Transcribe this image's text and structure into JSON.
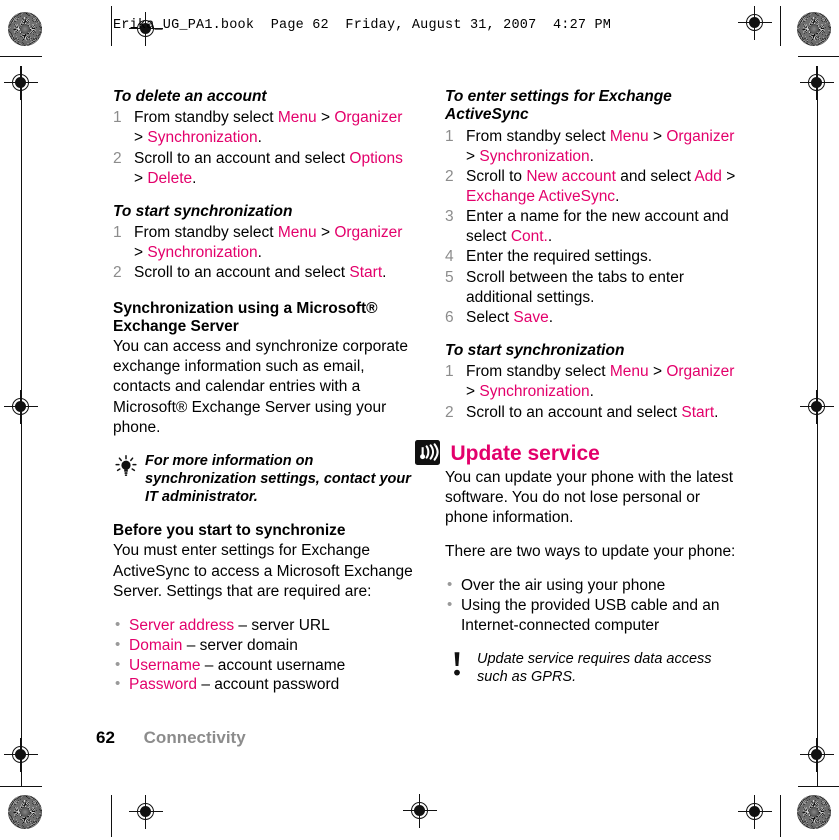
{
  "colors": {
    "accent": "#E3006B",
    "muted": "#8c8c8c",
    "text": "#000000"
  },
  "header": {
    "text": "Erika_UG_PA1.book  Page 62  Friday, August 31, 2007  4:27 PM"
  },
  "footer": {
    "page_number": "62",
    "chapter": "Connectivity"
  },
  "left_column": {
    "h_delete": "To delete an account",
    "delete_steps": [
      {
        "num": "1",
        "parts": [
          {
            "t": "From standby select ",
            "c": "blk"
          },
          {
            "t": "Menu",
            "c": "kw"
          },
          {
            "t": " > ",
            "c": "blk"
          },
          {
            "t": "Organizer",
            "c": "kw"
          },
          {
            "t": " > ",
            "c": "blk"
          },
          {
            "t": "Synchronization",
            "c": "kw"
          },
          {
            "t": ".",
            "c": "blk"
          }
        ]
      },
      {
        "num": "2",
        "parts": [
          {
            "t": "Scroll to an account and select ",
            "c": "blk"
          },
          {
            "t": "Options",
            "c": "kw"
          },
          {
            "t": " > ",
            "c": "blk"
          },
          {
            "t": "Delete",
            "c": "kw"
          },
          {
            "t": ".",
            "c": "blk"
          }
        ]
      }
    ],
    "h_start_sync": "To start synchronization",
    "start_sync_steps": [
      {
        "num": "1",
        "parts": [
          {
            "t": "From standby select ",
            "c": "blk"
          },
          {
            "t": "Menu",
            "c": "kw"
          },
          {
            "t": " > ",
            "c": "blk"
          },
          {
            "t": "Organizer",
            "c": "kw"
          },
          {
            "t": " > ",
            "c": "blk"
          },
          {
            "t": "Synchronization",
            "c": "kw"
          },
          {
            "t": ".",
            "c": "blk"
          }
        ]
      },
      {
        "num": "2",
        "parts": [
          {
            "t": "Scroll to an account and select ",
            "c": "blk"
          },
          {
            "t": "Start",
            "c": "kw"
          },
          {
            "t": ".",
            "c": "blk"
          }
        ]
      }
    ],
    "h_exchange": "Synchronization using a Microsoft® Exchange Server",
    "exchange_body": "You can access and synchronize corporate exchange information such as email, contacts and calendar entries with a Microsoft® Exchange Server using your phone.",
    "tip": {
      "icon": "lightbulb-icon",
      "text": "For more information on synchronization settings, contact your IT administrator."
    },
    "h_before": "Before you start to synchronize",
    "before_body": "You must enter settings for Exchange ActiveSync to access a Microsoft Exchange Server. Settings that are required are:",
    "settings_bullets": [
      {
        "term": "Server address",
        "desc": " – server URL"
      },
      {
        "term": "Domain",
        "desc": " – server domain"
      },
      {
        "term": "Username",
        "desc": " – account username"
      },
      {
        "term": "Password",
        "desc": " – account password"
      }
    ]
  },
  "right_column": {
    "h_enter_settings": "To enter settings for Exchange ActiveSync",
    "enter_steps": [
      {
        "num": "1",
        "parts": [
          {
            "t": "From standby select ",
            "c": "blk"
          },
          {
            "t": "Menu",
            "c": "kw"
          },
          {
            "t": " > ",
            "c": "blk"
          },
          {
            "t": "Organizer",
            "c": "kw"
          },
          {
            "t": " > ",
            "c": "blk"
          },
          {
            "t": "Synchronization",
            "c": "kw"
          },
          {
            "t": ".",
            "c": "blk"
          }
        ]
      },
      {
        "num": "2",
        "parts": [
          {
            "t": "Scroll to ",
            "c": "blk"
          },
          {
            "t": "New account",
            "c": "kw"
          },
          {
            "t": " and select ",
            "c": "blk"
          },
          {
            "t": "Add",
            "c": "kw"
          },
          {
            "t": " > ",
            "c": "blk"
          },
          {
            "t": "Exchange ActiveSync",
            "c": "kw"
          },
          {
            "t": ".",
            "c": "blk"
          }
        ]
      },
      {
        "num": "3",
        "parts": [
          {
            "t": "Enter a name for the new account and select ",
            "c": "blk"
          },
          {
            "t": "Cont.",
            "c": "kw"
          },
          {
            "t": ".",
            "c": "blk"
          }
        ]
      },
      {
        "num": "4",
        "parts": [
          {
            "t": "Enter the required settings.",
            "c": "blk"
          }
        ]
      },
      {
        "num": "5",
        "parts": [
          {
            "t": "Scroll between the tabs to enter additional settings.",
            "c": "blk"
          }
        ]
      },
      {
        "num": "6",
        "parts": [
          {
            "t": "Select ",
            "c": "blk"
          },
          {
            "t": "Save",
            "c": "kw"
          },
          {
            "t": ".",
            "c": "blk"
          }
        ]
      }
    ],
    "h_start_sync": "To start synchronization",
    "start_sync_steps": [
      {
        "num": "1",
        "parts": [
          {
            "t": "From standby select ",
            "c": "blk"
          },
          {
            "t": "Menu",
            "c": "kw"
          },
          {
            "t": " > ",
            "c": "blk"
          },
          {
            "t": "Organizer",
            "c": "kw"
          },
          {
            "t": " > ",
            "c": "blk"
          },
          {
            "t": "Synchronization",
            "c": "kw"
          },
          {
            "t": ".",
            "c": "blk"
          }
        ]
      },
      {
        "num": "2",
        "parts": [
          {
            "t": "Scroll to an account and select ",
            "c": "blk"
          },
          {
            "t": "Start",
            "c": "kw"
          },
          {
            "t": ".",
            "c": "blk"
          }
        ]
      }
    ],
    "section_icon": "broadcast-signal-icon",
    "section_title": "Update service",
    "update_body_1": "You can update your phone with the latest software. You do not lose personal or phone information.",
    "update_body_2": "There are two ways to update your phone:",
    "update_bullets": [
      "Over the air using your phone",
      "Using the provided USB cable and an Internet-connected computer"
    ],
    "note": {
      "icon": "exclamation-icon",
      "text": "Update service requires data access such as GPRS."
    }
  }
}
